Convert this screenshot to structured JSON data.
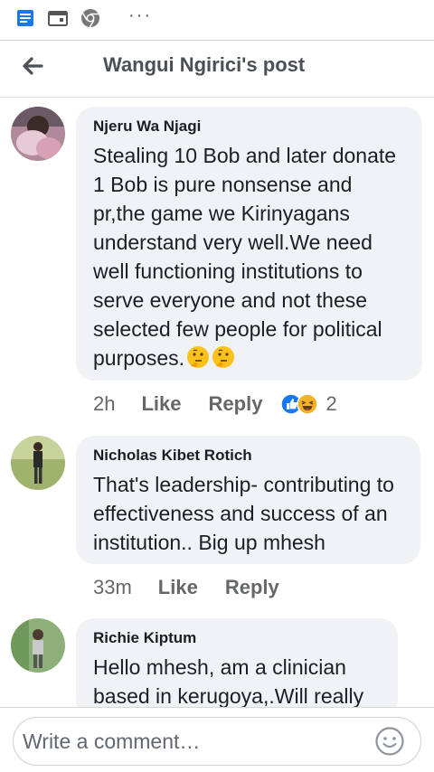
{
  "status_bar": {
    "dots": "···"
  },
  "header": {
    "title": "Wangui Ngirici's post"
  },
  "comments": [
    {
      "author": "Njeru Wa Njagi",
      "text": "Stealing 10 Bob and later donate 1 Bob is pure nonsense and pr,the game we Kirinyagans understand very well.We need well functioning institutions to serve everyone and not these selected few people for political purposes.",
      "time": "2h",
      "like": "Like",
      "reply": "Reply",
      "reaction_count": "2"
    },
    {
      "author": "Nicholas Kibet Rotich",
      "text": "That's leadership- contributing to effectiveness and success of an institution.. Big up mhesh",
      "time": "33m",
      "like": "Like",
      "reply": "Reply"
    },
    {
      "author": "Richie Kiptum",
      "text": "Hello mhesh, am a clinician based in kerugoya,.Will really"
    }
  ],
  "composer": {
    "placeholder": "Write a comment…"
  },
  "icons": [
    "news-feed-icon",
    "calendar-icon",
    "chrome-icon",
    "more-dots-icon",
    "back-arrow-icon",
    "thinking-emoji-icon",
    "like-reaction-icon",
    "haha-reaction-icon",
    "emoji-picker-icon"
  ],
  "colors": {
    "like_blue": "#1877f2",
    "haha_yellow": "#f7b125",
    "bubble": "#f0f2f5",
    "meta_gray": "#65676b"
  }
}
